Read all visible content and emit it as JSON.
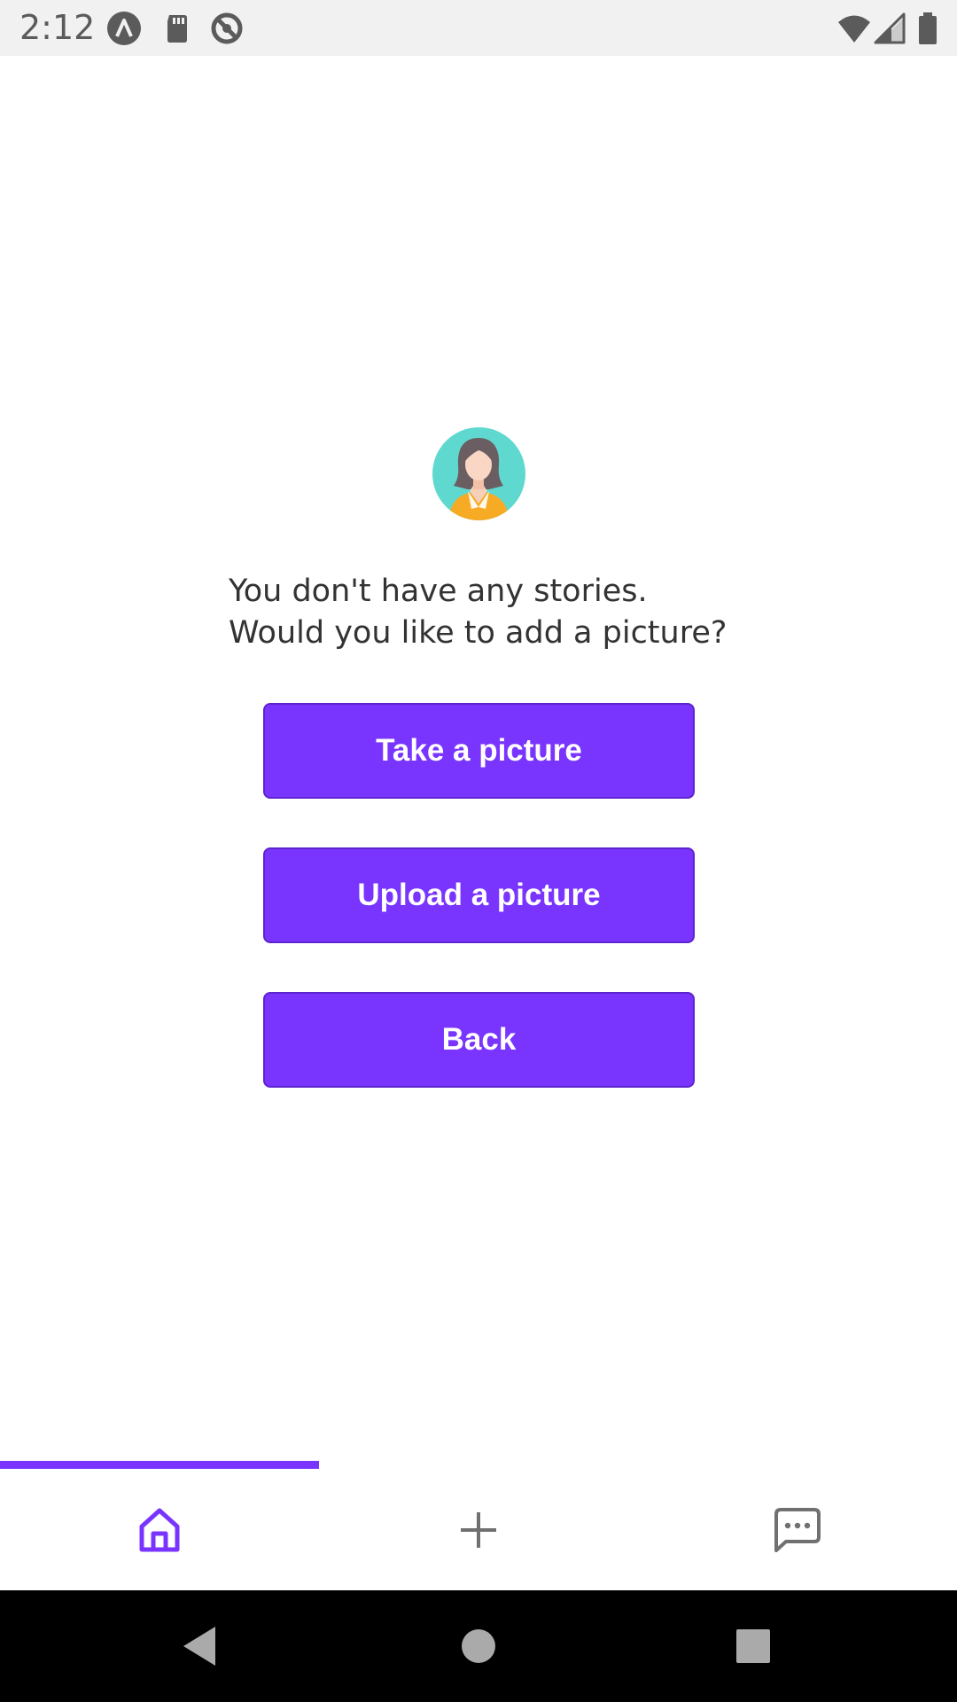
{
  "status_bar": {
    "time": "2:12",
    "left_icons": [
      "app-a-icon",
      "sd-card-icon",
      "data-saver-icon"
    ],
    "right_icons": [
      "wifi-icon",
      "signal-icon",
      "battery-icon"
    ]
  },
  "empty_state": {
    "avatar_icon": "woman-avatar-icon",
    "message_line1": "You don't have any stories.",
    "message_line2": "Would you like to add a picture?"
  },
  "actions": {
    "take_picture_label": "Take a picture",
    "upload_picture_label": "Upload a picture",
    "back_label": "Back"
  },
  "tab_bar": {
    "active_tab": "home",
    "tabs": [
      {
        "id": "home",
        "icon": "home-icon"
      },
      {
        "id": "add",
        "icon": "plus-icon"
      },
      {
        "id": "messages",
        "icon": "chat-icon"
      }
    ]
  },
  "colors": {
    "accent": "#7935fe",
    "text": "#333333",
    "status_bar_bg": "#f1f1f1",
    "inactive_icon": "#707070"
  }
}
